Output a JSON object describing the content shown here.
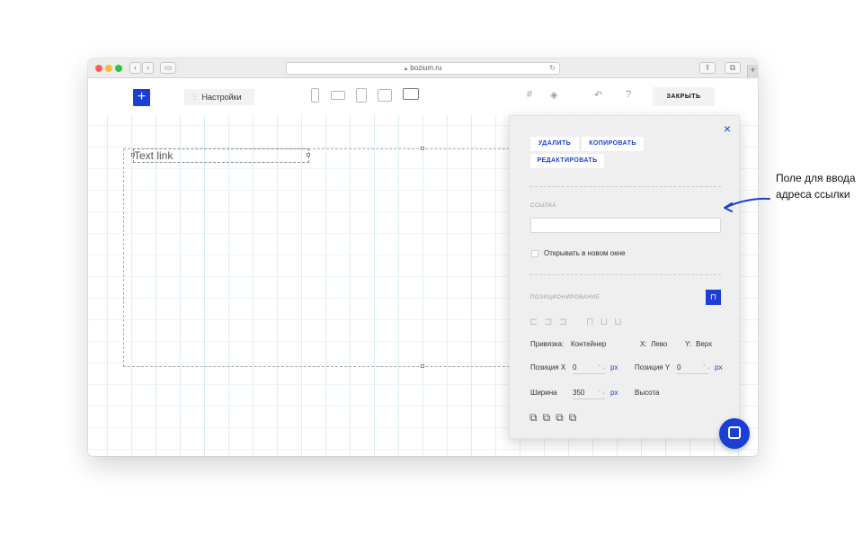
{
  "browser": {
    "address": "bozium.ru",
    "new_tab_label": "+"
  },
  "toolbar": {
    "add_label": "+",
    "settings_label": "Настройки",
    "close_label": "ЗАКРЫТЬ",
    "help_label": "?"
  },
  "canvas": {
    "text_element": "Text link"
  },
  "panel": {
    "close_icon": "×",
    "buttons": {
      "delete": "УДАЛИТЬ",
      "copy": "КОПИРОВАТЬ",
      "edit": "РЕДАКТИРОВАТЬ"
    },
    "link_section_label": "ССЫЛКА",
    "link_value": "",
    "new_window_label": "Открывать в новом окне",
    "new_window_checked": false,
    "positioning_label": "ПОЗИЦИОНИРОВАНИЕ",
    "anchor_label": "Привязка:",
    "anchor_value": "Контейнер",
    "x_label": "X:",
    "x_value": "Лево",
    "y_label": "Y:",
    "y_value": "Верх",
    "pos_x_label": "Позиция X",
    "pos_x_value": "0",
    "pos_y_label": "Позиция Y",
    "pos_y_value": "0",
    "width_label": "Ширина",
    "width_value": "350",
    "height_label": "Высота",
    "unit": "px"
  },
  "annotation": {
    "text": "Поле для ввода\nадреса ссылки"
  },
  "colors": {
    "accent": "#1a3fd4",
    "panel_bg": "#efefef"
  }
}
